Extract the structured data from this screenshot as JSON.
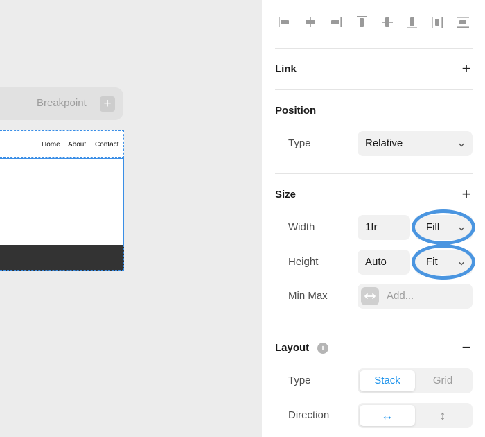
{
  "canvas": {
    "breakpoint_label": "Breakpoint",
    "breakpoint_add": "+",
    "nav_links": [
      "Home",
      "About",
      "Contact"
    ]
  },
  "panel": {
    "align_icons": [
      "align-left-icon",
      "align-center-h-icon",
      "align-right-icon",
      "align-top-icon",
      "align-center-v-icon",
      "align-bottom-icon",
      "distribute-h-icon",
      "distribute-v-icon"
    ],
    "link": {
      "title": "Link",
      "add": "+"
    },
    "position": {
      "title": "Position",
      "type_label": "Type",
      "type_value": "Relative"
    },
    "size": {
      "title": "Size",
      "add": "+",
      "width_label": "Width",
      "width_value": "1fr",
      "width_mode": "Fill",
      "height_label": "Height",
      "height_value": "Auto",
      "height_mode": "Fit",
      "minmax_label": "Min Max",
      "minmax_placeholder": "Add..."
    },
    "layout": {
      "title": "Layout",
      "info": "i",
      "collapse": "−",
      "type_label": "Type",
      "type_options": [
        "Stack",
        "Grid"
      ],
      "direction_label": "Direction",
      "direction_options": [
        "↔",
        "↕"
      ]
    }
  },
  "colors": {
    "accent": "#1991eb",
    "highlight": "#4a95e0",
    "frame_outline": "#3a8ee6",
    "footer": "#333333"
  }
}
